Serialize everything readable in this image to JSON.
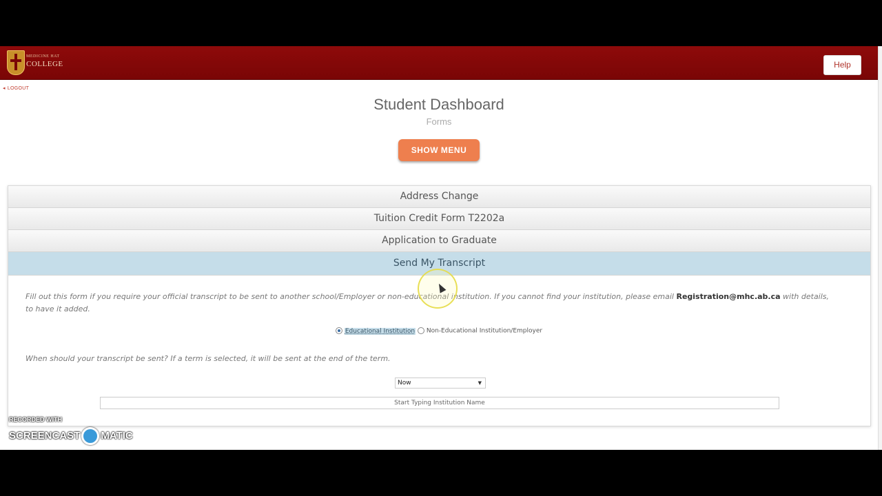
{
  "header": {
    "logo_small": "MEDICINE HAT",
    "logo_text": "COLLEGE",
    "help_label": "Help"
  },
  "nav": {
    "logout_label": "LOGOUT"
  },
  "page": {
    "title": "Student Dashboard",
    "subtitle": "Forms",
    "show_menu_label": "SHOW MENU"
  },
  "forms": {
    "items": [
      {
        "label": "Address Change"
      },
      {
        "label": "Tuition Credit Form T2202a"
      },
      {
        "label": "Application to Graduate"
      },
      {
        "label": "Send My Transcript",
        "active": true
      }
    ]
  },
  "transcript_form": {
    "description_before": "Fill out this form if you require your official transcript to be sent to another school/Employer or non-educational institution. If you cannot find your institution, please email ",
    "email": "Registration@mhc.ab.ca",
    "description_after": " with details, to have it added.",
    "radio_options": [
      {
        "label": "Educational Institution",
        "selected": true
      },
      {
        "label": "Non-Educational Institution/Employer",
        "selected": false
      }
    ],
    "when_question": "When should your transcript be sent? If a term is selected, it will be sent at the end of the term.",
    "when_value": "Now",
    "institution_placeholder": "Start Typing Institution Name"
  },
  "watermark": {
    "line1": "RECORDED WITH",
    "line2_a": "SCREENCAST",
    "line2_b": "MATIC"
  },
  "colors": {
    "header": "#7a0606",
    "accent": "#ee7f4e",
    "active_tab": "#c5dde9"
  }
}
